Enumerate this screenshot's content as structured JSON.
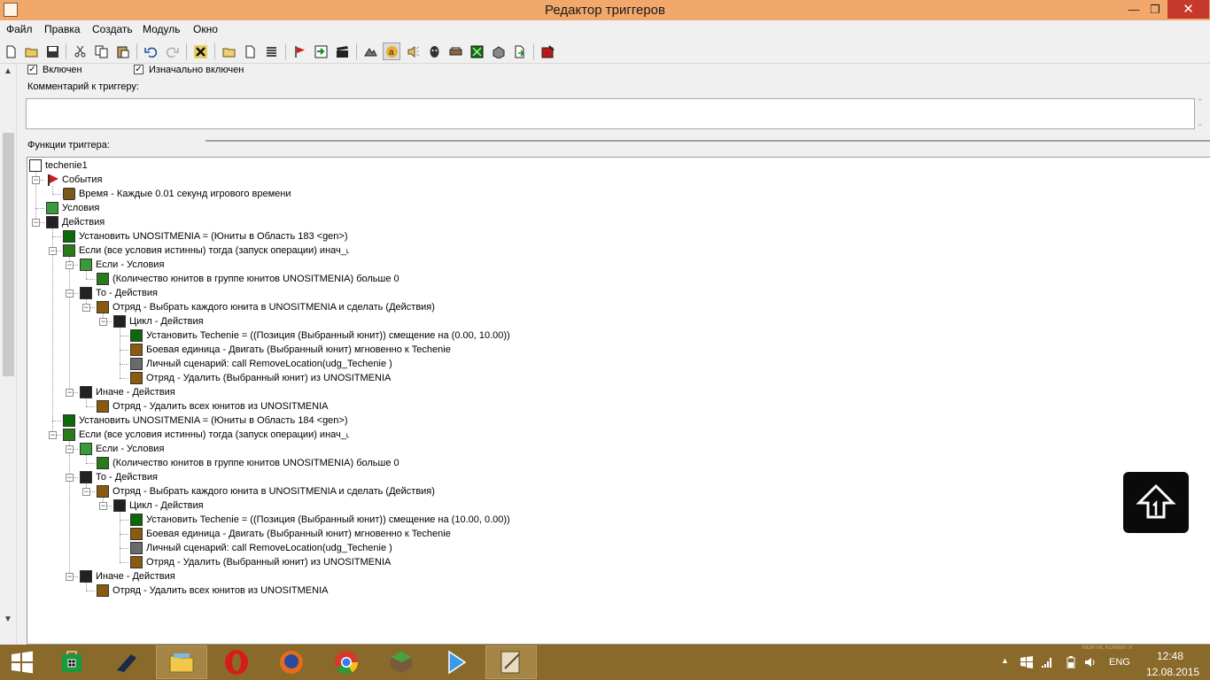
{
  "window": {
    "title": "Редактор триггеров",
    "minimize_glyph": "—",
    "restore_glyph": "❐",
    "close_glyph": "✕"
  },
  "menu": [
    "Файл",
    "Правка",
    "Создать",
    "Модуль",
    "Окно"
  ],
  "toolbar": {
    "buttons": [
      "new-doc-icon",
      "open-folder-icon",
      "save-icon",
      "cut-icon",
      "copy-icon",
      "paste-icon",
      "undo-icon",
      "redo-icon",
      "delete-x-icon",
      "new-category-icon",
      "new-trigger-icon",
      "new-comment-icon",
      "new-event-icon",
      "new-condition-icon",
      "new-action-icon",
      "terrain-icon",
      "text-a-icon",
      "sound-icon",
      "ai-icon",
      "object-icon",
      "campaign-icon",
      "import-icon",
      "module-icon",
      "test-map-icon"
    ]
  },
  "options": {
    "enabled_label": "Включен",
    "initially_enabled_label": "Изначально включен",
    "enabled_checked": true,
    "initially_enabled_checked": true,
    "comment_label": "Комментарий к триггеру:",
    "functions_label": "Функции триггера:"
  },
  "tree": [
    {
      "text": "techenie1",
      "icon": "doc"
    },
    {
      "text": "События",
      "icon": "flag"
    },
    {
      "text": "Время - Каждые 0.01 секунд игрового времени",
      "icon": "clock"
    },
    {
      "text": "Условия",
      "icon": "cond"
    },
    {
      "text": "Действия",
      "icon": "act"
    },
    {
      "text": "Установить UNOSITMENIA = (Юниты в Область 183 <gen>)",
      "icon": "set"
    },
    {
      "text": "Если (все условия истинны) тогда (запуск операции) инач_˪",
      "icon": "if"
    },
    {
      "text": "Если - Условия",
      "icon": "cond"
    },
    {
      "text": "(Количество юнитов в группе юнитов UNOSITMENIA) больше 0",
      "icon": "if"
    },
    {
      "text": "То - Действия",
      "icon": "act"
    },
    {
      "text": "Отряд - Выбрать каждого юнита в UNOSITMENIA и сделать (Действия)",
      "icon": "unit"
    },
    {
      "text": "Цикл - Действия",
      "icon": "act"
    },
    {
      "text": "Установить Techenie = ((Позиция (Выбранный юнит)) смещение на (0.00, 10.00))",
      "icon": "set"
    },
    {
      "text": "Боевая единица - Двигать (Выбранный юнит) мгновенно к Techenie",
      "icon": "unit"
    },
    {
      "text": "Личный сценарий:   call RemoveLocation(udg_Techenie )",
      "icon": "script"
    },
    {
      "text": "Отряд - Удалить (Выбранный юнит) из UNOSITMENIA",
      "icon": "unit"
    },
    {
      "text": "Иначе - Действия",
      "icon": "act"
    },
    {
      "text": "Отряд - Удалить всех юнитов из UNOSITMENIA",
      "icon": "unit"
    },
    {
      "text": "Установить UNOSITMENIA = (Юниты в Область 184 <gen>)",
      "icon": "set"
    },
    {
      "text": "Если (все условия истинны) тогда (запуск операции) инач_˪",
      "icon": "if"
    },
    {
      "text": "Если - Условия",
      "icon": "cond"
    },
    {
      "text": "(Количество юнитов в группе юнитов UNOSITMENIA) больше 0",
      "icon": "if"
    },
    {
      "text": "То - Действия",
      "icon": "act"
    },
    {
      "text": "Отряд - Выбрать каждого юнита в UNOSITMENIA и сделать (Действия)",
      "icon": "unit"
    },
    {
      "text": "Цикл - Действия",
      "icon": "act"
    },
    {
      "text": "Установить Techenie = ((Позиция (Выбранный юнит)) смещение на (10.00, 0.00))",
      "icon": "set"
    },
    {
      "text": "Боевая единица - Двигать (Выбранный юнит) мгновенно к Techenie",
      "icon": "unit"
    },
    {
      "text": "Личный сценарий:   call RemoveLocation(udg_Techenie )",
      "icon": "script"
    },
    {
      "text": "Отряд - Удалить (Выбранный юнит) из UNOSITMENIA",
      "icon": "unit"
    },
    {
      "text": "Иначе - Действия",
      "icon": "act"
    },
    {
      "text": "Отряд - Удалить всех юнитов из UNOSITMENIA",
      "icon": "unit"
    }
  ],
  "taskbar": {
    "apps": [
      "start-icon",
      "store-icon",
      "blade-icon",
      "file-explorer-icon",
      "opera-icon",
      "firefox-icon",
      "chrome-icon",
      "minecraft-icon",
      "play-icon",
      "world-editor-icon"
    ],
    "watermark": "MORTAL KOMBAT X",
    "language": "ENG",
    "time": "12:48",
    "date": "12.08.2015"
  }
}
